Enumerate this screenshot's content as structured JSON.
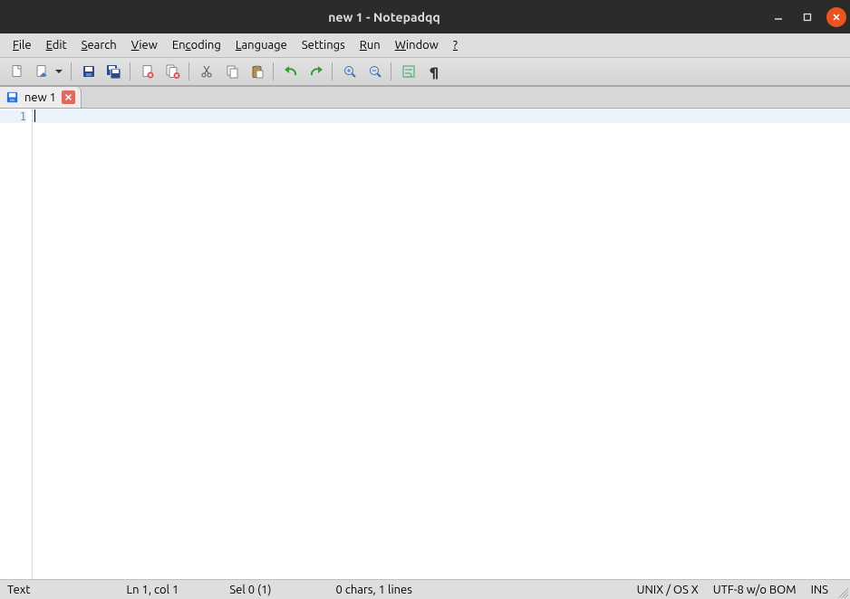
{
  "title": "new 1 - Notepadqq",
  "menu": {
    "file": {
      "label": "File",
      "mn": "F",
      "rest": "ile"
    },
    "edit": {
      "label": "Edit",
      "mn": "E",
      "rest": "dit"
    },
    "search": {
      "label": "Search",
      "mn": "S",
      "rest": "earch"
    },
    "view": {
      "label": "View",
      "mn": "V",
      "rest": "iew"
    },
    "encoding": {
      "label": "Encoding",
      "mn": "c",
      "pre": "En",
      "rest": "oding"
    },
    "language": {
      "label": "Language",
      "mn": "L",
      "rest": "anguage"
    },
    "settings": {
      "label": "Settings"
    },
    "run": {
      "label": "Run",
      "mn": "R",
      "rest": "un"
    },
    "window": {
      "label": "Window",
      "mn": "W",
      "rest": "indow"
    },
    "help": {
      "label": "?",
      "mn": "?"
    }
  },
  "toolbar_icons": {
    "new_file": "new-file-icon",
    "open_file": "open-file-icon",
    "save": "save-icon",
    "save_all": "save-all-icon",
    "close": "close-doc-icon",
    "close_all": "close-all-docs-icon",
    "cut": "cut-icon",
    "copy": "copy-icon",
    "paste": "paste-icon",
    "undo": "undo-icon",
    "redo": "redo-icon",
    "zoom_in": "zoom-in-icon",
    "zoom_out": "zoom-out-icon",
    "word_wrap": "word-wrap-icon",
    "show_symbols": "pilcrow-icon"
  },
  "tabs": [
    {
      "label": "new 1",
      "modified": true
    }
  ],
  "editor": {
    "line_numbers": [
      "1"
    ],
    "content": ""
  },
  "status": {
    "language": "Text",
    "position": "Ln 1, col 1",
    "selection": "Sel 0 (1)",
    "stats": "0 chars, 1 lines",
    "eol": "UNIX / OS X",
    "encoding": "UTF-8 w/o BOM",
    "insert_mode": "INS"
  }
}
